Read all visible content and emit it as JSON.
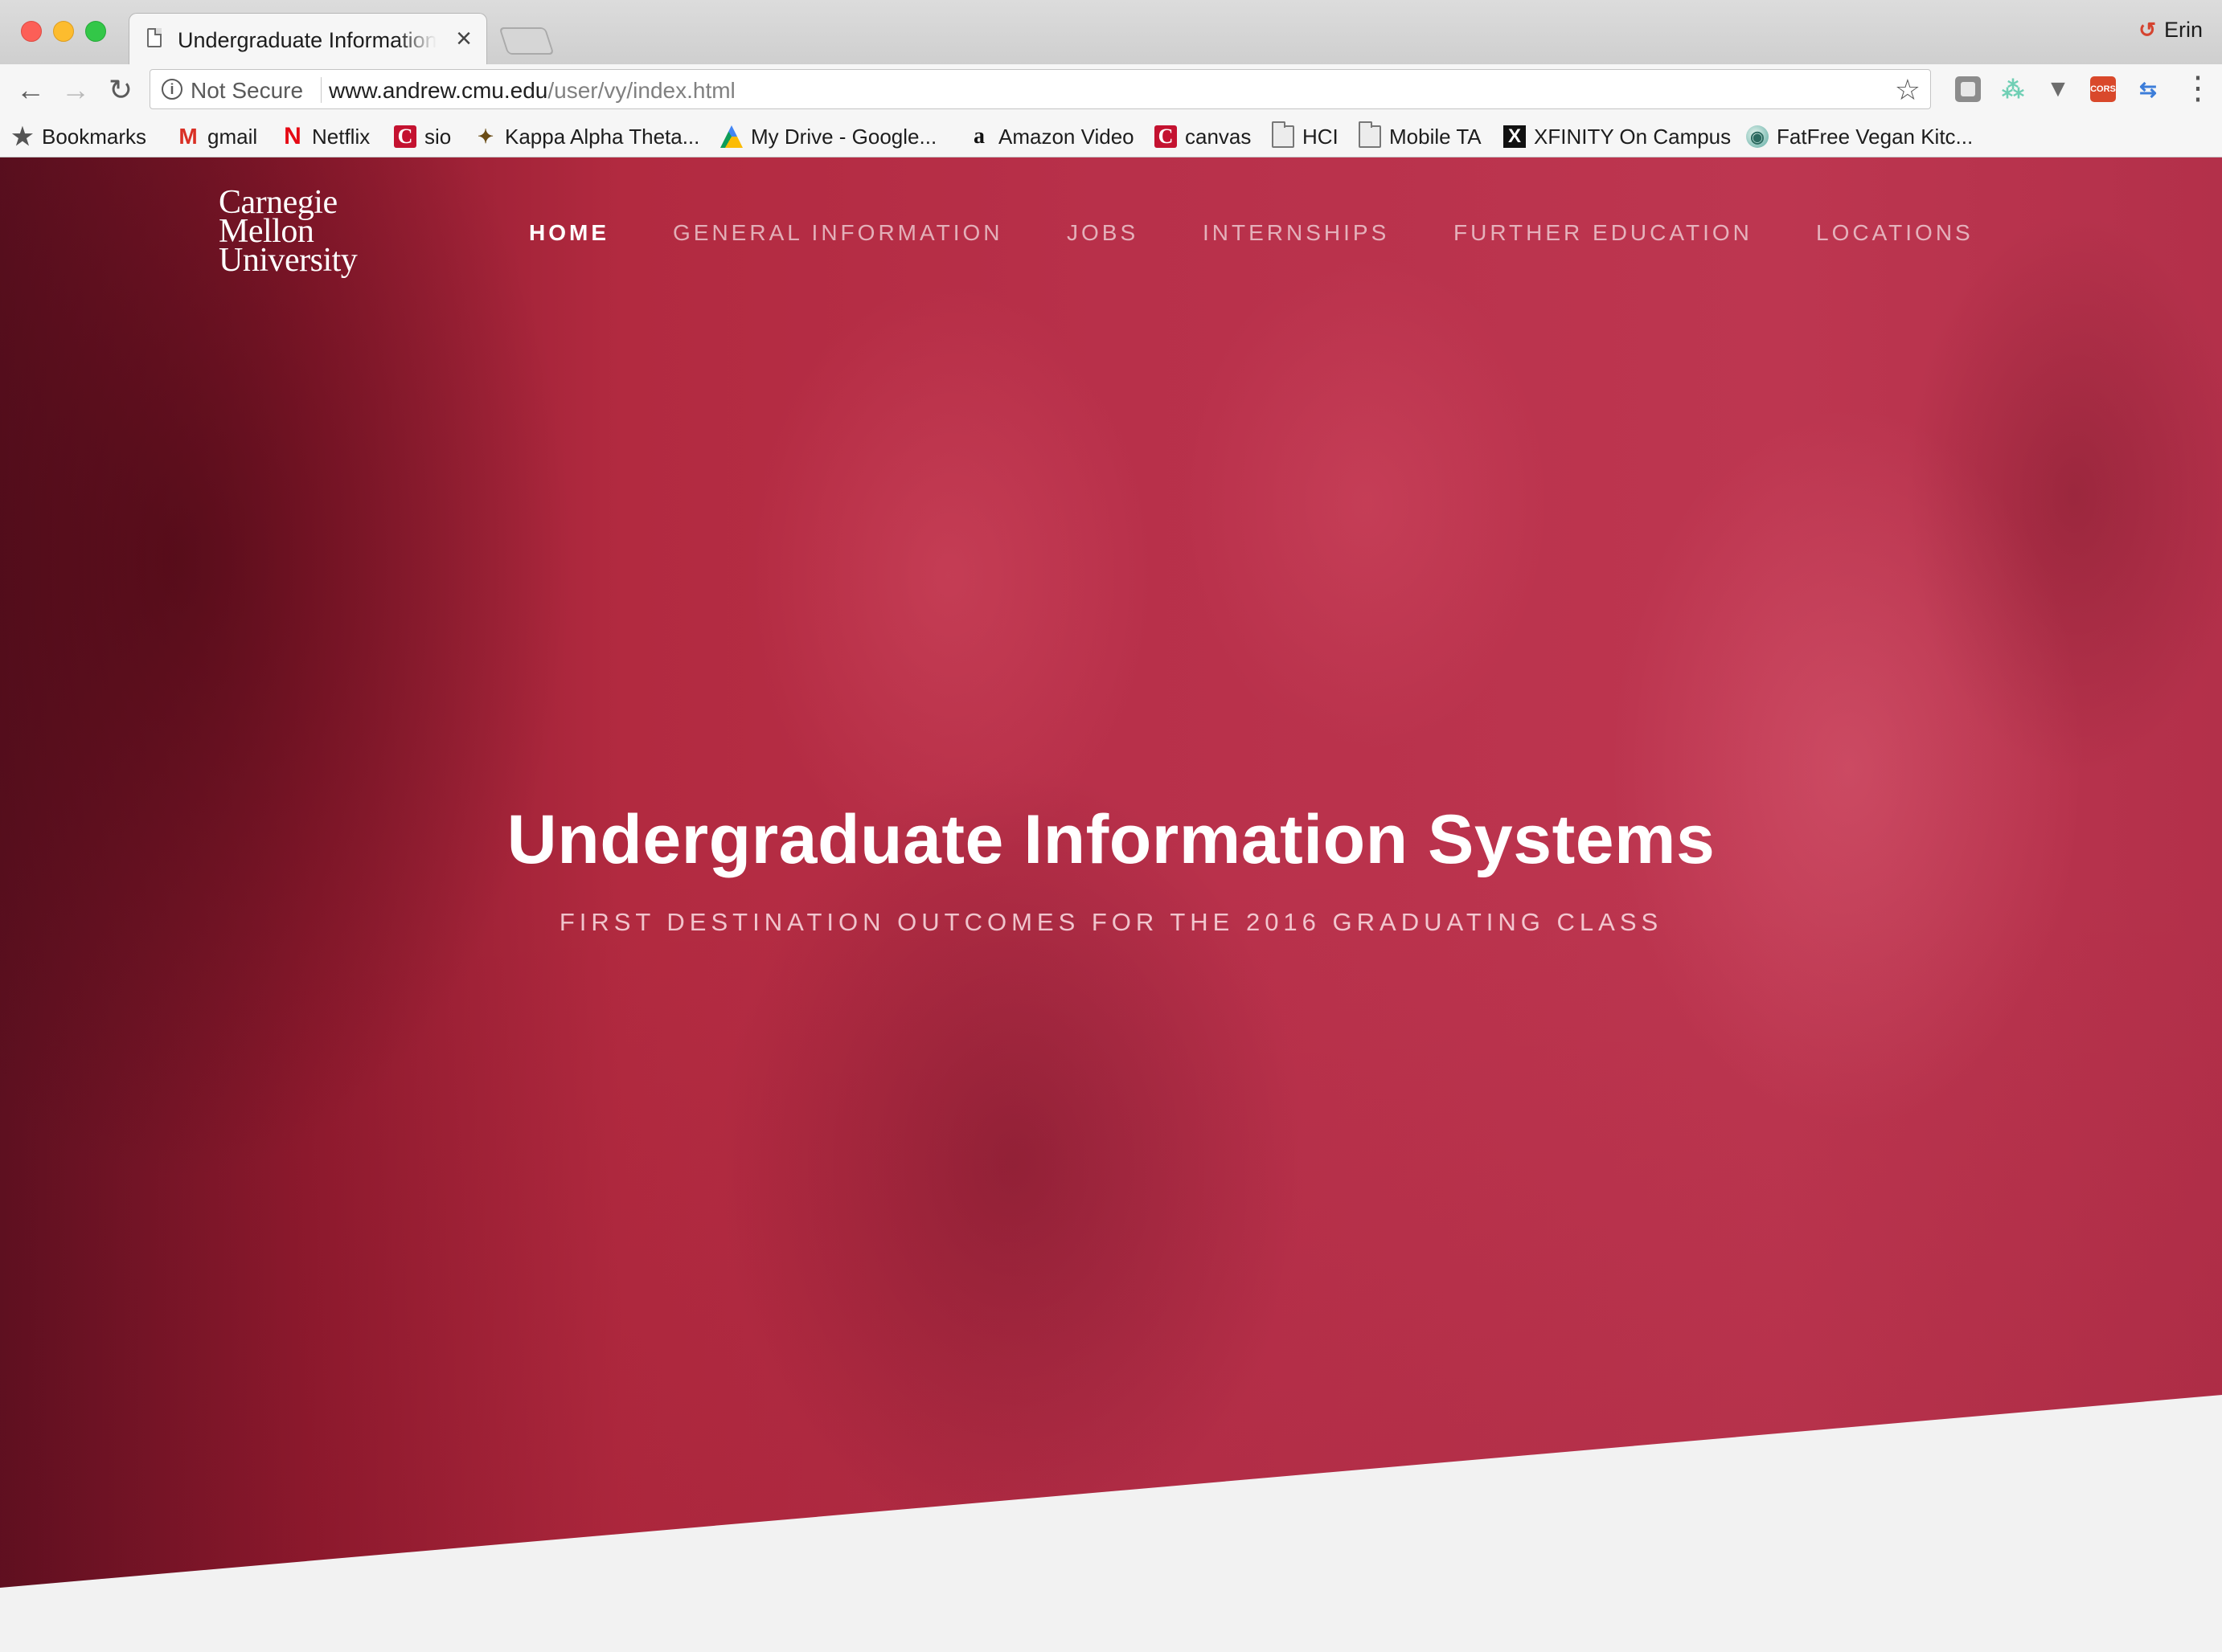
{
  "browser": {
    "tab": {
      "title": "Undergraduate Information Systems"
    },
    "profile_name": "Erin",
    "address": {
      "security_label": "Not Secure",
      "url_domain": "www.andrew.cmu.edu",
      "url_path": "/user/vy/index.html"
    },
    "bookmarks": [
      {
        "label": "Bookmarks",
        "icon": "star-icon"
      },
      {
        "label": "gmail",
        "icon": "gmail-icon"
      },
      {
        "label": "Netflix",
        "icon": "netflix-icon"
      },
      {
        "label": "sio",
        "icon": "cmu-icon"
      },
      {
        "label": "Kappa Alpha Theta...",
        "icon": "kappa-icon"
      },
      {
        "label": "My Drive - Google...",
        "icon": "google-drive-icon"
      },
      {
        "label": "Amazon Video",
        "icon": "amazon-icon"
      },
      {
        "label": "canvas",
        "icon": "cmu-icon"
      },
      {
        "label": "HCI",
        "icon": "folder-icon"
      },
      {
        "label": "Mobile TA",
        "icon": "folder-icon"
      },
      {
        "label": "XFINITY On Campus",
        "icon": "xfinity-icon"
      },
      {
        "label": "FatFree Vegan Kitc...",
        "icon": "fatfree-icon"
      }
    ],
    "icons": {
      "canvas_glyph": "C",
      "xfinity_glyph": "X",
      "amazon_glyph": "a",
      "gmail_glyph": "M",
      "netflix_glyph": "N",
      "cors_label": "CORS"
    }
  },
  "site": {
    "logo": {
      "line1": "Carnegie",
      "line2": "Mellon",
      "line3": "University"
    },
    "nav": [
      {
        "label": "HOME",
        "active": true
      },
      {
        "label": "GENERAL INFORMATION",
        "active": false
      },
      {
        "label": "JOBS",
        "active": false
      },
      {
        "label": "INTERNSHIPS",
        "active": false
      },
      {
        "label": "FURTHER EDUCATION",
        "active": false
      },
      {
        "label": "LOCATIONS",
        "active": false
      }
    ],
    "hero": {
      "title": "Undergraduate Information Systems",
      "subtitle": "FIRST DESTINATION OUTCOMES FOR THE 2016 GRADUATING CLASS"
    }
  },
  "colors": {
    "brand_red": "#b8304a",
    "page_bg": "#f2f2f2"
  }
}
